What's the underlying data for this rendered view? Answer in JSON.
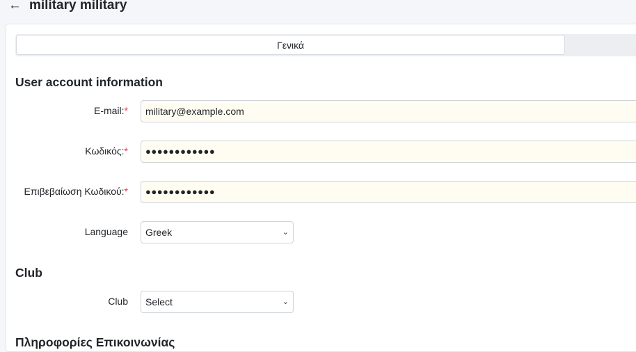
{
  "header": {
    "back_icon": "←",
    "title": "military military"
  },
  "tabs": [
    {
      "label": "Γενικά",
      "active": true
    }
  ],
  "sections": {
    "account": {
      "title": "User account information",
      "email": {
        "label": "E-mail:",
        "required": "*",
        "value": "military@example.com"
      },
      "password": {
        "label": "Κωδικός:",
        "required": "*",
        "value": "●●●●●●●●●●●●"
      },
      "password_confirm": {
        "label": "Επιβεβαίωση Κωδικού:",
        "required": "*",
        "value": "●●●●●●●●●●●●"
      },
      "language": {
        "label": "Language",
        "selected": "Greek"
      }
    },
    "club": {
      "title": "Club",
      "club": {
        "label": "Club",
        "selected": "Select"
      }
    },
    "contact": {
      "title": "Πληροφορίες Επικοινωνίας"
    }
  },
  "icons": {
    "chevron": "⌄"
  },
  "colors": {
    "required": "#dc3545",
    "input_bg": "#fffdf2",
    "page_bg": "#f4f6f9"
  }
}
